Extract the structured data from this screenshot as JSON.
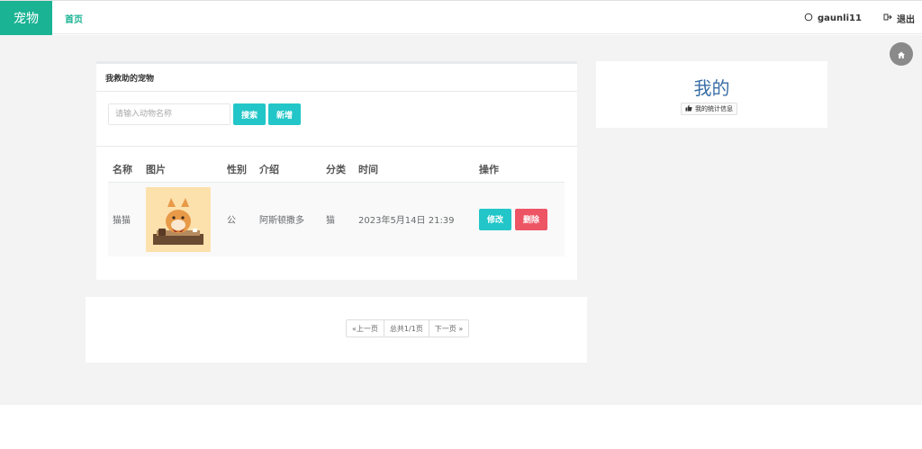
{
  "brand": {
    "name": "宠物",
    "color": "#1ab394"
  },
  "nav": {
    "home": "首页",
    "user": {
      "icon": "user-icon",
      "name": "gaunli11"
    },
    "logout": {
      "icon": "logout-icon",
      "label": "退出"
    }
  },
  "home_fab": {
    "icon": "home-icon"
  },
  "rescue_panel": {
    "title": "我救助的宠物",
    "search": {
      "placeholder": "请输入动物名称",
      "value": ""
    },
    "search_button": "搜索",
    "add_button": "新增",
    "table": {
      "headers": {
        "name": "名称",
        "image": "图片",
        "gender": "性别",
        "intro": "介绍",
        "category": "分类",
        "time": "时间",
        "ops": "操作"
      },
      "rows": [
        {
          "name": "猫猫",
          "image": "shiba-cartoon-image",
          "gender": "公",
          "intro": "阿斯顿撒多",
          "category": "猫",
          "time": "2023年5月14日 21:39",
          "edit": "修改",
          "delete": "删除"
        }
      ]
    }
  },
  "pagination": {
    "prev": "«上一页",
    "total": "总共1/1页",
    "next": "下一页 »"
  },
  "side_panel": {
    "title": "我的",
    "badge": {
      "icon": "thumbs-up-icon",
      "label": "我的统计信息"
    }
  },
  "colors": {
    "accent": "#1ab394",
    "info": "#23c6c8",
    "danger": "#ed5565",
    "link_title": "#3a6ea5"
  }
}
